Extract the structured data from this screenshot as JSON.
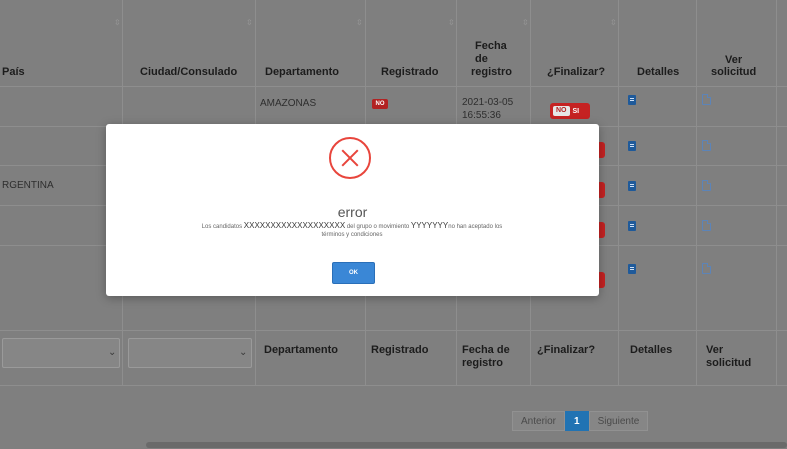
{
  "table": {
    "headers": {
      "pais": "País",
      "ciudad": "Ciudad/Consulado",
      "departamento": "Departamento",
      "registrado": "Registrado",
      "fecha_line1": "Fecha",
      "fecha_line2": "de",
      "fecha_line3": "registro",
      "finalizar": "¿Finalizar?",
      "detalles": "Detalles",
      "ver_line1": "Ver",
      "ver_line2": "solicitud"
    },
    "rows": [
      {
        "pais": "",
        "departamento": "AMAZONAS",
        "registrado": "NO",
        "fecha_line1": "2021-03-05",
        "fecha_line2": "16:55:36",
        "toggle_no": "NO",
        "toggle_si": "SI"
      },
      {
        "pais": ""
      },
      {
        "pais": "RGENTINA"
      },
      {
        "pais": ""
      },
      {
        "pais": ""
      }
    ],
    "footer": {
      "departamento": "Departamento",
      "registrado": "Registrado",
      "fecha_line1": "Fecha de",
      "fecha_line2": "registro",
      "finalizar": "¿Finalizar?",
      "detalles": "Detalles",
      "ver_line1": "Ver",
      "ver_line2": "solicitud"
    }
  },
  "pagination": {
    "prev": "Anterior",
    "current": "1",
    "next": "Siguiente"
  },
  "modal": {
    "icon": "error-x-icon",
    "title": "error",
    "msg_prefix": "Los candidatos",
    "candidates": "XXXXXXXXXXXXXXXXXXX",
    "msg_middle": "del grupo o movimiento",
    "group": "YYYYYYY",
    "msg_suffix": "no han aceptado los",
    "msg_line2": "términos y condiciones",
    "ok_label": "OK"
  },
  "colors": {
    "error": "#e8453c",
    "ok_button": "#3a87d6",
    "badge_red": "#b22222",
    "pager_active": "#2173b3"
  }
}
